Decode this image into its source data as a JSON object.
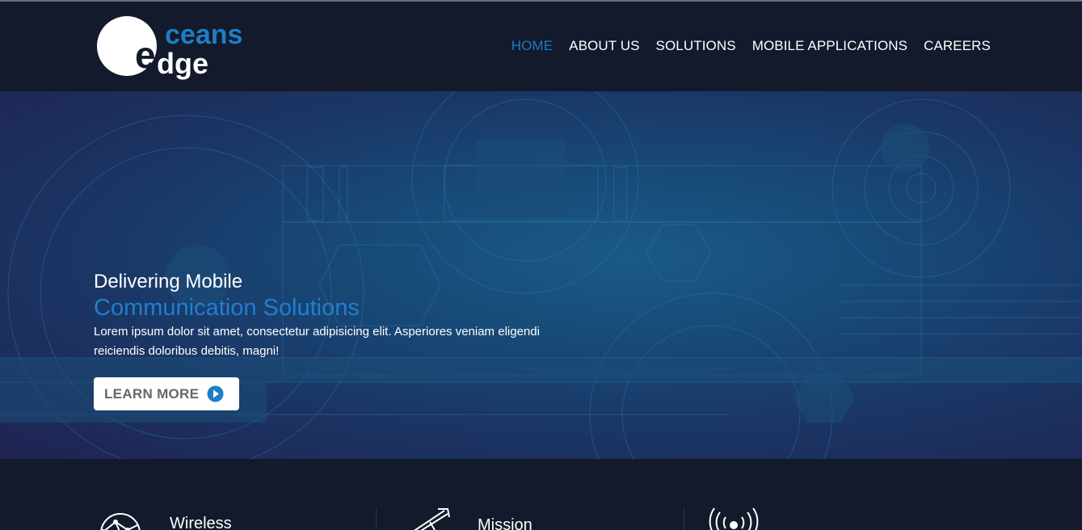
{
  "brand": {
    "logo_top": "ceans",
    "logo_bottom": "dge",
    "logo_letter": "e",
    "colors": {
      "primary": "#1e7dc6",
      "dark": "#121a2b",
      "white": "#ffffff"
    }
  },
  "nav": {
    "items": [
      {
        "label": "HOME",
        "active": true
      },
      {
        "label": "ABOUT US",
        "active": false
      },
      {
        "label": "SOLUTIONS",
        "active": false
      },
      {
        "label": "MOBILE APPLICATIONS",
        "active": false
      },
      {
        "label": "CAREERS",
        "active": false
      }
    ]
  },
  "hero": {
    "title": "Delivering Mobile",
    "subtitle": "Communication Solutions",
    "text": "Lorem ipsum dolor sit amet, consectetur adipisicing elit. Asperiores veniam eligendi reiciendis doloribus debitis, magni!",
    "button_label": "LEARN MORE",
    "button_icon": "play-circle-icon"
  },
  "features": [
    {
      "title": "Wireless",
      "icon": "network-globe-icon"
    },
    {
      "title": "Mission",
      "icon": "rocket-icon"
    },
    {
      "title": "",
      "icon": "broadcast-signal-icon"
    }
  ]
}
